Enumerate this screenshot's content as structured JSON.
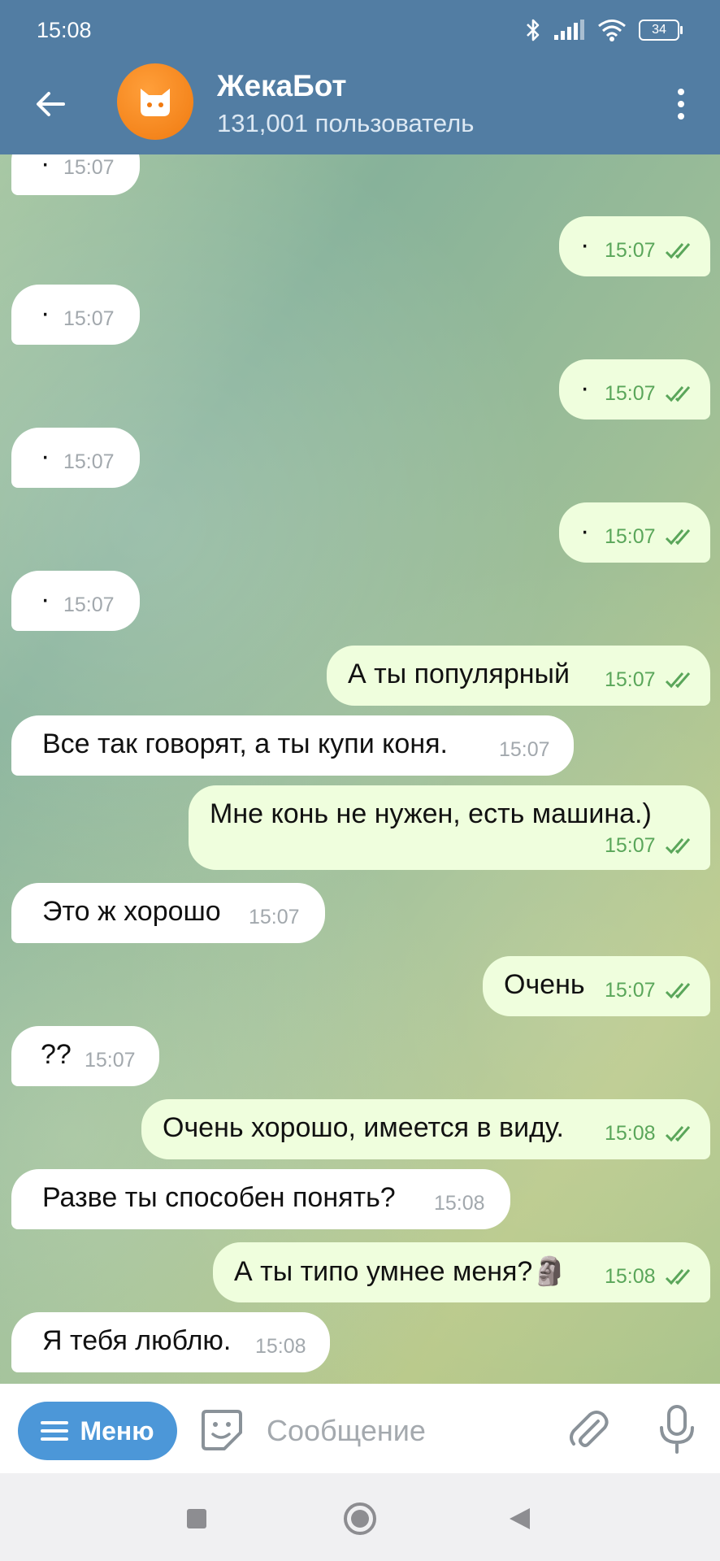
{
  "status_bar": {
    "time": "15:08",
    "battery": "34"
  },
  "header": {
    "title": "ЖекаБот",
    "subtitle": "131,001 пользователь"
  },
  "messages": [
    {
      "dir": "in",
      "text": "·",
      "time": "15:07"
    },
    {
      "dir": "out",
      "text": "·",
      "time": "15:07",
      "read": true
    },
    {
      "dir": "in",
      "text": "·",
      "time": "15:07"
    },
    {
      "dir": "out",
      "text": "·",
      "time": "15:07",
      "read": true
    },
    {
      "dir": "in",
      "text": "·",
      "time": "15:07"
    },
    {
      "dir": "out",
      "text": "·",
      "time": "15:07",
      "read": true
    },
    {
      "dir": "in",
      "text": "·",
      "time": "15:07"
    },
    {
      "dir": "out",
      "text": "А ты популярный",
      "time": "15:07",
      "read": true
    },
    {
      "dir": "in",
      "text": "Все так говорят, а ты купи коня.",
      "time": "15:07"
    },
    {
      "dir": "out",
      "text": "Мне конь не нужен, есть машина.)",
      "time": "15:07",
      "read": true
    },
    {
      "dir": "in",
      "text": "Это ж хорошо",
      "time": "15:07"
    },
    {
      "dir": "out",
      "text": "Очень",
      "time": "15:07",
      "read": true
    },
    {
      "dir": "in",
      "text": "??",
      "time": "15:07"
    },
    {
      "dir": "out",
      "text": "Очень хорошо, имеется в виду.",
      "time": "15:08",
      "read": true
    },
    {
      "dir": "in",
      "text": "Разве ты способен понять?",
      "time": "15:08"
    },
    {
      "dir": "out",
      "text": "А ты типо умнее меня?",
      "emoji": "🗿",
      "time": "15:08",
      "read": true
    },
    {
      "dir": "in",
      "text": "Я тебя люблю.",
      "time": "15:08"
    }
  ],
  "input_bar": {
    "menu_label": "Меню",
    "placeholder": "Сообщение"
  },
  "icons": {
    "back": "arrow-left-icon",
    "more": "more-vertical-icon",
    "menu": "hamburger-icon",
    "sticker": "sticker-icon",
    "attach": "paperclip-icon",
    "mic": "microphone-icon",
    "nav": [
      "square-icon",
      "circle-icon",
      "triangle-left-icon"
    ]
  },
  "colors": {
    "header": "#527da3",
    "menu_button": "#4c97d8",
    "outgoing_bubble": "#effedd",
    "read_checks": "#5aa65a"
  }
}
